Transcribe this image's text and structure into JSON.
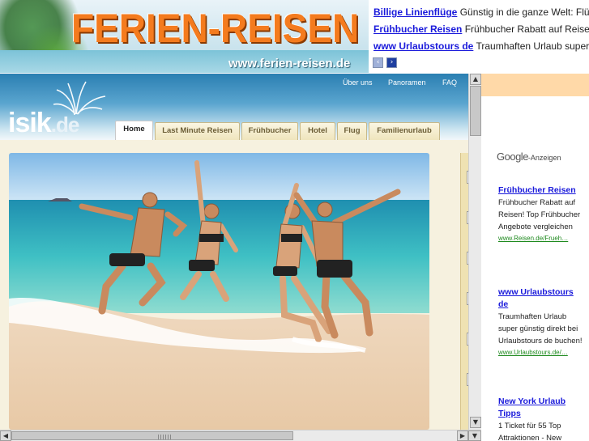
{
  "banner": {
    "title": "FERIEN-REISEN",
    "url": "www.ferien-reisen.de"
  },
  "top_ads": [
    {
      "link": "Billige Linienflüge",
      "text": "Günstig in die ganze Welt: Flü"
    },
    {
      "link": "Frühbucher Reisen",
      "text": "Frühbucher Rabatt auf Reisen"
    },
    {
      "link": "www Urlaubstours de",
      "text": "Traumhaften Urlaub super g"
    }
  ],
  "pager": {
    "prev": "‹",
    "next": "›"
  },
  "site": {
    "logo_main": "isik",
    "logo_tld": ".de",
    "top_nav": [
      "Über uns",
      "Panoramen",
      "FAQ"
    ],
    "tabs": [
      {
        "label": "Home",
        "active": true
      },
      {
        "label": "Last Minute Reisen",
        "active": false
      },
      {
        "label": "Frühbucher",
        "active": false
      },
      {
        "label": "Hotel",
        "active": false
      },
      {
        "label": "Flug",
        "active": false
      },
      {
        "label": "Familienurlaub",
        "active": false
      }
    ]
  },
  "google": {
    "brand": "Google",
    "suffix": "-Anzeigen",
    "ads": [
      {
        "title": "Frühbucher Reisen",
        "desc": "Frühbucher Rabatt auf Reisen! Top Frühbucher Angebote vergleichen",
        "url": "www.Reisen.de/Frueh…"
      },
      {
        "title": "www Urlaubstours de",
        "desc": "Traumhaften Urlaub super günstig direkt bei Urlaubstours de buchen!",
        "url": "www.Urlaubstours.de/…"
      },
      {
        "title": "New York Urlaub Tipps",
        "desc": "1 Ticket für 55 Top Attraktionen - New",
        "url": ""
      }
    ]
  },
  "colors": {
    "banner_title": "#f47b1e",
    "ad_link": "#1a1adb",
    "ad_url": "#1f8a1f",
    "tab_bg": "#efe5bd",
    "header_blue": "#2b7fb2"
  },
  "icons": {
    "scroll_up": "▲",
    "scroll_down": "▼",
    "scroll_left": "◀",
    "scroll_right": "▶"
  }
}
